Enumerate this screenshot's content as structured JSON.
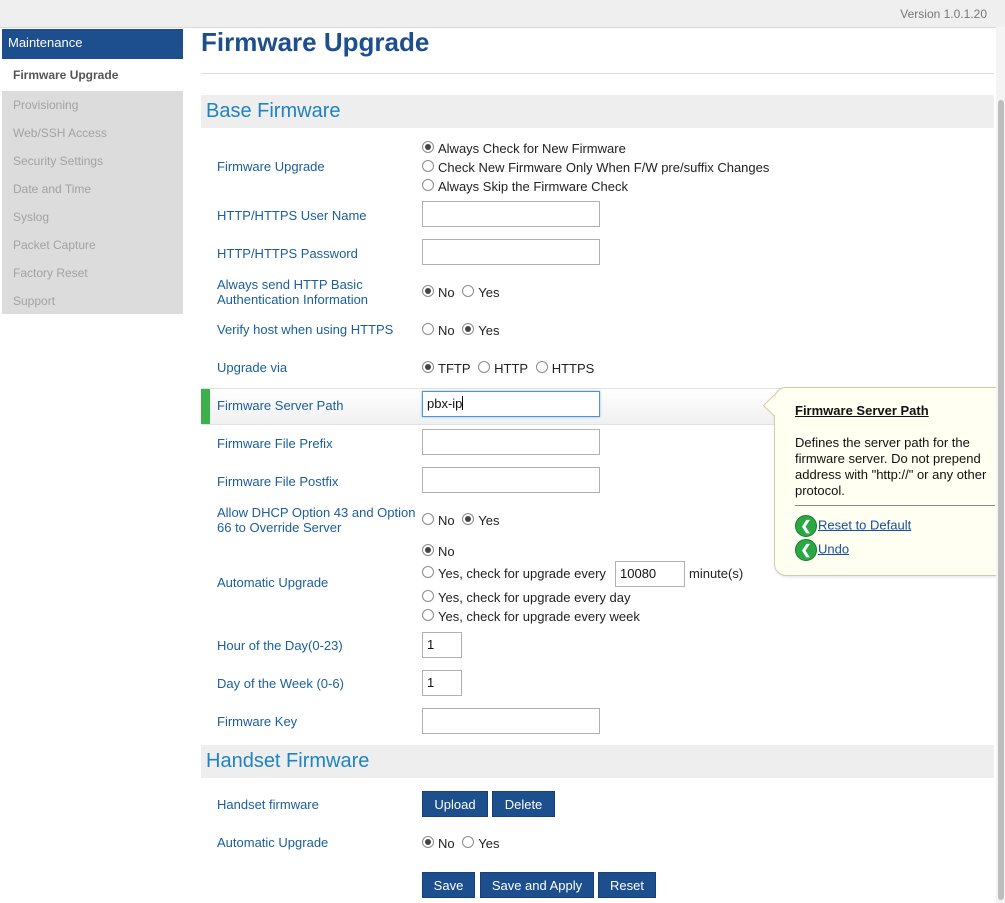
{
  "version": "Version 1.0.1.20",
  "sidebar": {
    "header": "Maintenance",
    "items": [
      {
        "label": "Firmware Upgrade"
      },
      {
        "label": "Provisioning"
      },
      {
        "label": "Web/SSH Access"
      },
      {
        "label": "Security Settings"
      },
      {
        "label": "Date and Time"
      },
      {
        "label": "Syslog"
      },
      {
        "label": "Packet Capture"
      },
      {
        "label": "Factory Reset"
      },
      {
        "label": "Support"
      }
    ]
  },
  "page": {
    "title": "Firmware Upgrade"
  },
  "base": {
    "heading": "Base Firmware",
    "firmware_upgrade": {
      "label": "Firmware Upgrade",
      "options": [
        "Always Check for New Firmware",
        "Check New Firmware Only When F/W pre/suffix Changes",
        "Always Skip the Firmware Check"
      ],
      "selected": 0
    },
    "username": {
      "label": "HTTP/HTTPS User Name",
      "value": ""
    },
    "password": {
      "label": "HTTP/HTTPS Password",
      "value": ""
    },
    "basic_auth": {
      "label": "Always send HTTP Basic Authentication Information",
      "options": [
        "No",
        "Yes"
      ],
      "selected": 0
    },
    "verify_host": {
      "label": "Verify host when using HTTPS",
      "options": [
        "No",
        "Yes"
      ],
      "selected": 1
    },
    "upgrade_via": {
      "label": "Upgrade via",
      "options": [
        "TFTP",
        "HTTP",
        "HTTPS"
      ],
      "selected": 0
    },
    "server_path": {
      "label": "Firmware Server Path",
      "value": "pbx-ip"
    },
    "prefix": {
      "label": "Firmware File Prefix",
      "value": ""
    },
    "postfix": {
      "label": "Firmware File Postfix",
      "value": ""
    },
    "dhcp_override": {
      "label": "Allow DHCP Option 43 and Option 66 to Override Server",
      "options": [
        "No",
        "Yes"
      ],
      "selected": 1
    },
    "auto_upgrade": {
      "label": "Automatic Upgrade",
      "option_no": "No",
      "option_every_prefix": "Yes, check for upgrade every",
      "minutes_value": "10080",
      "minutes_unit": "minute(s)",
      "option_day": "Yes, check for upgrade every day",
      "option_week": "Yes, check for upgrade every week",
      "selected": 0
    },
    "hour": {
      "label": "Hour of the Day(0-23)",
      "value": "1"
    },
    "day": {
      "label": "Day of the Week (0-6)",
      "value": "1"
    },
    "key": {
      "label": "Firmware Key",
      "value": ""
    }
  },
  "handset": {
    "heading": "Handset Firmware",
    "firmware": {
      "label": "Handset firmware",
      "upload": "Upload",
      "delete": "Delete"
    },
    "auto_upgrade": {
      "label": "Automatic Upgrade",
      "options": [
        "No",
        "Yes"
      ],
      "selected": 0
    }
  },
  "actions": {
    "save": "Save",
    "save_apply": "Save and Apply",
    "reset": "Reset"
  },
  "tooltip": {
    "title": "Firmware Server Path",
    "description": "Defines the server path for the firmware server. Do not prepend address with \"http://\" or any other protocol.",
    "reset_default": "Reset to Default",
    "undo": "Undo"
  },
  "colors": {
    "primary": "#1d4f8f",
    "section_title": "#1e83c4",
    "label": "#1a5e9a",
    "highlight": "#3cb04b"
  }
}
